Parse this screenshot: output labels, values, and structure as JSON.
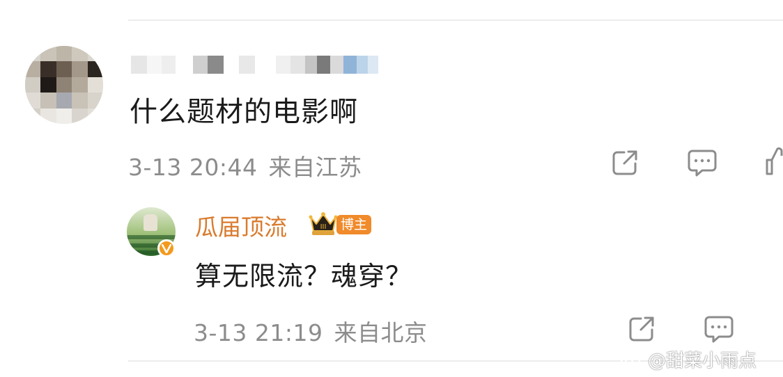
{
  "comment": {
    "text": "什么题材的电影啊",
    "time": "3-13 20:44",
    "location": "来自江苏"
  },
  "reply": {
    "username": "瓜届顶流",
    "badge": "博主",
    "text": "算无限流？魂穿？",
    "time": "3-13 21:19",
    "location": "来自北京"
  },
  "watermark": "@甜菜小雨点",
  "icons": {
    "share": "share-icon",
    "comment": "comment-icon",
    "like": "like-icon",
    "crown": "crown-icon",
    "verified": "verified-badge-icon",
    "weibo": "weibo-logo-icon"
  },
  "colors": {
    "username": "#d97b2e",
    "badge_bg": "#f08a2a",
    "meta_text": "#8c8c8c",
    "verified": "#f39a1e"
  }
}
